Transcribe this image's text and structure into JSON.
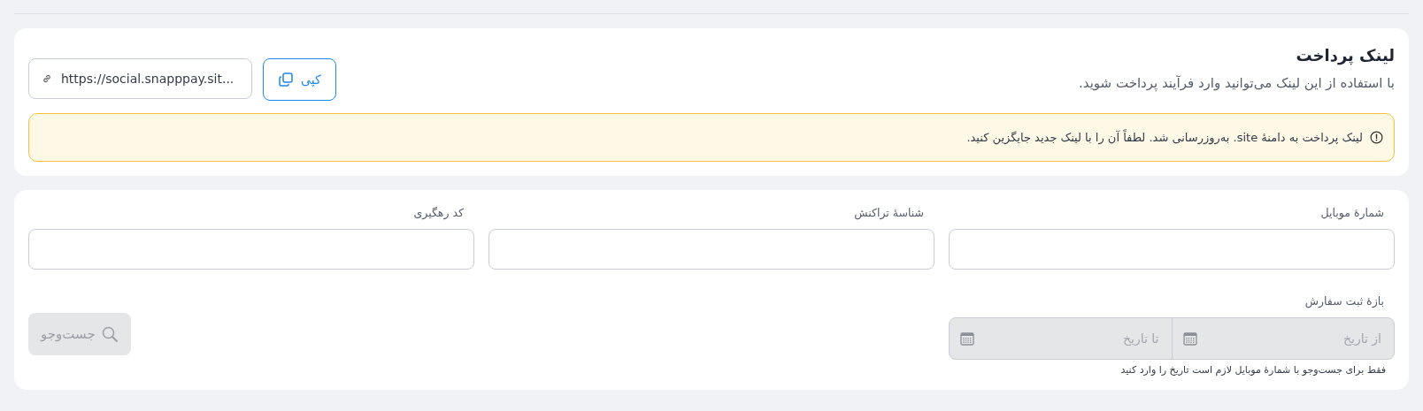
{
  "payment_link": {
    "title": "لینک پرداخت",
    "description": "با استفاده از این لینک می‌توانید وارد فرآیند پرداخت شوید.",
    "link_field": {
      "value": "https://social.snapppay.sit..."
    },
    "copy_button": {
      "label": "کپی"
    },
    "notice": "لینک پرداخت به دامنهٔ site. به‌روزرسانی شد. لطفاً آن را با لینک جدید جایگزین کنید."
  },
  "filters": {
    "fields": [
      {
        "label": "شمارهٔ موبایل"
      },
      {
        "label": "شناسهٔ تراکنش"
      },
      {
        "label": "کد رهگیری"
      }
    ],
    "date_range": {
      "label": "بازهٔ ثبت سفارش",
      "disabled": true,
      "from": {
        "placeholder": "از تاریخ"
      },
      "to": {
        "placeholder": "تا تاریخ"
      },
      "hint": "فقط برای جست‌وجو با شمارهٔ موبایل لازم است تاریخ را وارد کنید"
    },
    "search_button": {
      "label": "جست‌وجو",
      "disabled": true
    }
  }
}
